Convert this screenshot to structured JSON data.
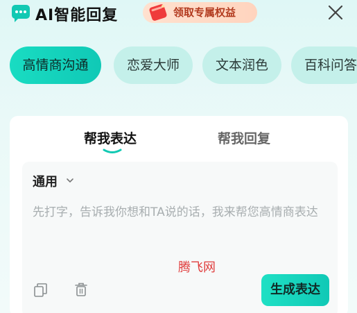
{
  "header": {
    "title": "AI智能回复",
    "promo_label": "领取专属权益",
    "icons": {
      "logo": "chat-bubble-icon",
      "promo": "gift-icon",
      "close": "close-icon"
    }
  },
  "tabs": [
    {
      "label": "高情商沟通",
      "active": true
    },
    {
      "label": "恋爱大师",
      "active": false
    },
    {
      "label": "文本润色",
      "active": false
    },
    {
      "label": "百科问答",
      "active": false
    }
  ],
  "card": {
    "sub_tabs": [
      {
        "label": "帮我表达",
        "active": true
      },
      {
        "label": "帮我回复",
        "active": false
      }
    ],
    "mode_label": "通用",
    "input": {
      "value": "",
      "placeholder": "先打字，告诉我你想和TA说的话，我来帮您高情商表达"
    },
    "watermark": "腾飞网",
    "generate_label": "生成表达",
    "icons": {
      "copy": "copy-icon",
      "delete": "trash-icon",
      "mode": "chevron-down-icon"
    }
  },
  "colors": {
    "accent": "#12c9b3",
    "chip_inactive": "#c4f0ea",
    "promo_bg": "#ffd9c4",
    "promo_text": "#b23a1e"
  }
}
